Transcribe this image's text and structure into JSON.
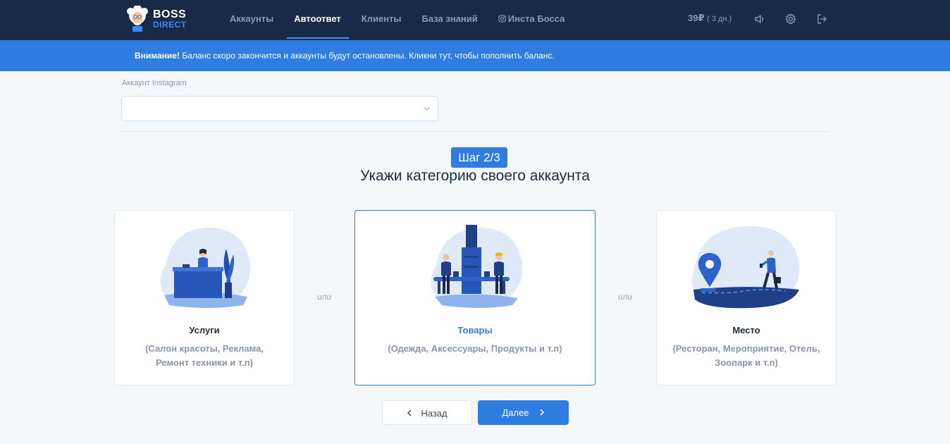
{
  "header": {
    "logo_line1": "BOSS",
    "logo_line2": "DIRECT",
    "nav": [
      {
        "label": "Аккаунты",
        "active": false
      },
      {
        "label": "Автоответ",
        "active": true
      },
      {
        "label": "Клиенты",
        "active": false
      },
      {
        "label": "База знаний",
        "active": false
      },
      {
        "label": "Инста Босса",
        "active": false,
        "icon": "instagram-icon"
      }
    ],
    "balance": "39₽",
    "balance_days": "( 3 дн.)",
    "icons": [
      "sound-icon",
      "gear-icon",
      "logout-icon"
    ]
  },
  "banner": {
    "strong": "Внимание!",
    "text": " Баланс скоро закончится и аккаунты будут остановлены. Кликни тут, чтобы пополнить баланс."
  },
  "account": {
    "label": "Аккаунт Instagram",
    "value": ""
  },
  "step": {
    "badge": "Шаг 2/3",
    "title": "Укажи категорию своего аккаунта"
  },
  "cards": [
    {
      "title": "Услуги",
      "desc": "(Салон красоты, Реклама, Ремонт техники и т.п)",
      "selected": false
    },
    {
      "title": "Товары",
      "desc": "(Одежда, Аксессуары, Продукты и т.п)",
      "selected": true
    },
    {
      "title": "Место",
      "desc": "(Ресторан, Мероприятие, Отель, Зоопарк и т.п)",
      "selected": false
    }
  ],
  "separator": "или",
  "buttons": {
    "back": "Назад",
    "next": "Далее"
  },
  "colors": {
    "topbar": "#182a45",
    "accent": "#2f7de1",
    "background": "#f4f8fb"
  }
}
